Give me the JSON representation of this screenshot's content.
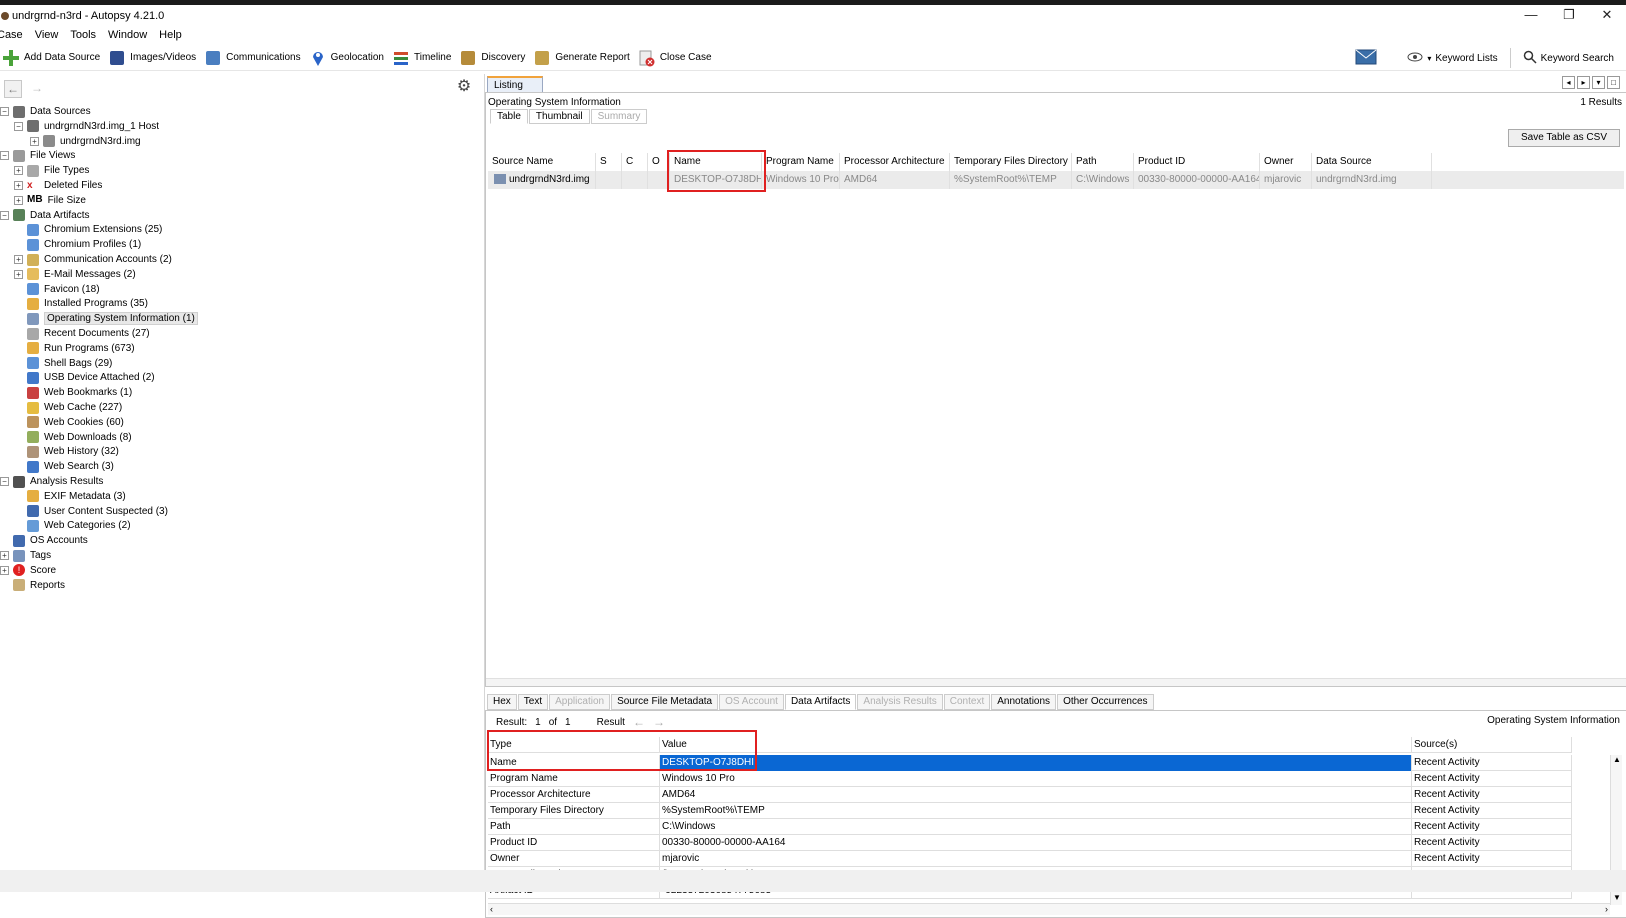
{
  "window": {
    "title": "undrgrnd-n3rd - Autopsy 4.21.0",
    "controls": [
      "—",
      "❐",
      "✕"
    ]
  },
  "menu": [
    "Case",
    "View",
    "Tools",
    "Window",
    "Help"
  ],
  "toolbar": {
    "buttons": [
      {
        "label": "Add Data Source",
        "icon": "plus-icon",
        "color": "#4aa33a"
      },
      {
        "label": "Images/Videos",
        "icon": "images-icon",
        "color": "#2f4d8f"
      },
      {
        "label": "Communications",
        "icon": "communications-icon",
        "color": "#4a7ec0"
      },
      {
        "label": "Geolocation",
        "icon": "map-pin-icon",
        "color": "#2a64c8"
      },
      {
        "label": "Timeline",
        "icon": "timeline-icon",
        "color": "#d04c2c"
      },
      {
        "label": "Discovery",
        "icon": "discovery-icon",
        "color": "#b58b3a"
      },
      {
        "label": "Generate Report",
        "icon": "report-icon",
        "color": "#c3a04a"
      },
      {
        "label": "Close Case",
        "icon": "close-case-icon",
        "color": "#d03030"
      }
    ],
    "keyword_lists": "Keyword Lists",
    "keyword_search": "Keyword Search"
  },
  "tree": {
    "items": [
      {
        "label": "Data Sources",
        "level": 0,
        "expander": "−",
        "icon": "data-sources-icon",
        "color": "#555"
      },
      {
        "label": "undrgrndN3rd.img_1 Host",
        "level": 1,
        "expander": "−",
        "icon": "host-icon",
        "color": "#555"
      },
      {
        "label": "undrgrndN3rd.img",
        "level": 2,
        "expander": "+",
        "icon": "disk-image-icon",
        "color": "#777"
      },
      {
        "label": "File Views",
        "level": 0,
        "expander": "−",
        "icon": "file-views-icon",
        "color": "#888"
      },
      {
        "label": "File Types",
        "level": 1,
        "expander": "+",
        "icon": "file-types-icon",
        "color": "#999"
      },
      {
        "label": "Deleted Files",
        "level": 1,
        "expander": "+",
        "icon": "deleted-files-icon",
        "color": "#d02020"
      },
      {
        "label": "File Size",
        "level": 1,
        "expander": "+",
        "icon": "file-size-icon",
        "color": "#000"
      },
      {
        "label": "Data Artifacts",
        "level": 0,
        "expander": "−",
        "icon": "data-artifacts-icon",
        "color": "#3b6b3b"
      },
      {
        "label": "Chromium Extensions (25)",
        "level": 1,
        "expander": "",
        "icon": "chromium-icon",
        "color": "#3f7fd0"
      },
      {
        "label": "Chromium Profiles (1)",
        "level": 1,
        "expander": "",
        "icon": "chromium-icon",
        "color": "#3f7fd0"
      },
      {
        "label": "Communication Accounts (2)",
        "level": 1,
        "expander": "+",
        "icon": "accounts-icon",
        "color": "#c9a23a"
      },
      {
        "label": "E-Mail Messages (2)",
        "level": 1,
        "expander": "+",
        "icon": "email-icon",
        "color": "#e0b040"
      },
      {
        "label": "Favicon (18)",
        "level": 1,
        "expander": "",
        "icon": "favicon-icon",
        "color": "#3f7fd0"
      },
      {
        "label": "Installed Programs (35)",
        "level": 1,
        "expander": "",
        "icon": "installed-programs-icon",
        "color": "#e0a020"
      },
      {
        "label": "Operating System Information (1)",
        "level": 1,
        "expander": "",
        "icon": "os-info-icon",
        "color": "#6a86b0",
        "selected": true
      },
      {
        "label": "Recent Documents (27)",
        "level": 1,
        "expander": "",
        "icon": "recent-documents-icon",
        "color": "#999"
      },
      {
        "label": "Run Programs (673)",
        "level": 1,
        "expander": "",
        "icon": "run-programs-icon",
        "color": "#e0a020"
      },
      {
        "label": "Shell Bags (29)",
        "level": 1,
        "expander": "",
        "icon": "shell-bags-icon",
        "color": "#3f7fd0"
      },
      {
        "label": "USB Device Attached (2)",
        "level": 1,
        "expander": "",
        "icon": "usb-icon",
        "color": "#2060c0"
      },
      {
        "label": "Web Bookmarks (1)",
        "level": 1,
        "expander": "",
        "icon": "bookmark-icon",
        "color": "#c02020"
      },
      {
        "label": "Web Cache (227)",
        "level": 1,
        "expander": "",
        "icon": "web-cache-icon",
        "color": "#e0b020"
      },
      {
        "label": "Web Cookies (60)",
        "level": 1,
        "expander": "",
        "icon": "cookie-icon",
        "color": "#b08040"
      },
      {
        "label": "Web Downloads (8)",
        "level": 1,
        "expander": "",
        "icon": "download-icon",
        "color": "#80a040"
      },
      {
        "label": "Web History (32)",
        "level": 1,
        "expander": "",
        "icon": "history-icon",
        "color": "#a08060"
      },
      {
        "label": "Web Search (3)",
        "level": 1,
        "expander": "",
        "icon": "web-search-icon",
        "color": "#2060c0"
      },
      {
        "label": "Analysis Results",
        "level": 0,
        "expander": "−",
        "icon": "analysis-results-icon",
        "color": "#333"
      },
      {
        "label": "EXIF Metadata (3)",
        "level": 1,
        "expander": "",
        "icon": "exif-icon",
        "color": "#e0a020"
      },
      {
        "label": "User Content Suspected (3)",
        "level": 1,
        "expander": "",
        "icon": "user-content-icon",
        "color": "#2050a0"
      },
      {
        "label": "Web Categories (2)",
        "level": 1,
        "expander": "",
        "icon": "web-categories-icon",
        "color": "#4a8ad0"
      },
      {
        "label": "OS Accounts",
        "level": 0,
        "expander": "",
        "icon": "os-accounts-icon",
        "color": "#2050a0"
      },
      {
        "label": "Tags",
        "level": 0,
        "expander": "+",
        "icon": "tags-icon",
        "color": "#6080b0"
      },
      {
        "label": "Score",
        "level": 0,
        "expander": "+",
        "icon": "score-icon",
        "color": "#e02020"
      },
      {
        "label": "Reports",
        "level": 0,
        "expander": "",
        "icon": "reports-icon",
        "color": "#c0a060"
      }
    ],
    "file_size_prefix": "MB"
  },
  "listing": {
    "tab": "Listing",
    "title": "Operating System Information",
    "results": "1 Results",
    "subtabs": [
      {
        "label": "Table",
        "state": "active"
      },
      {
        "label": "Thumbnail",
        "state": "normal"
      },
      {
        "label": "Summary",
        "state": "disabled"
      }
    ],
    "save_csv": "Save Table as CSV",
    "columns": [
      "Source Name",
      "S",
      "C",
      "O",
      "Name",
      "Program Name",
      "Processor Architecture",
      "Temporary Files Directory",
      "Path",
      "Product ID",
      "Owner",
      "Data Source"
    ],
    "row": [
      "undrgrndN3rd.img",
      "",
      "",
      "",
      "DESKTOP-O7J8DHI",
      "Windows 10 Pro",
      "AMD64",
      "%SystemRoot%\\TEMP",
      "C:\\Windows",
      "00330-80000-00000-AA164",
      "mjarovic",
      "undrgrndN3rd.img"
    ]
  },
  "viewer": {
    "tabs": [
      {
        "label": "Hex",
        "state": "normal"
      },
      {
        "label": "Text",
        "state": "normal"
      },
      {
        "label": "Application",
        "state": "disabled"
      },
      {
        "label": "Source File Metadata",
        "state": "normal"
      },
      {
        "label": "OS Account",
        "state": "disabled"
      },
      {
        "label": "Data Artifacts",
        "state": "active"
      },
      {
        "label": "Analysis Results",
        "state": "disabled"
      },
      {
        "label": "Context",
        "state": "disabled"
      },
      {
        "label": "Annotations",
        "state": "normal"
      },
      {
        "label": "Other Occurrences",
        "state": "normal"
      }
    ],
    "result_label": "Result:",
    "result_index": "1",
    "of_label": "of",
    "result_total": "1",
    "result_nav_label": "Result",
    "right_title": "Operating System Information",
    "headers": [
      "Type",
      "Value",
      "Source(s)"
    ],
    "rows": [
      {
        "type": "Name",
        "value": "DESKTOP-O7J8DHI",
        "source": "Recent Activity",
        "selected": true
      },
      {
        "type": "Program Name",
        "value": "Windows 10 Pro",
        "source": "Recent Activity"
      },
      {
        "type": "Processor Architecture",
        "value": "AMD64",
        "source": "Recent Activity"
      },
      {
        "type": "Temporary Files Directory",
        "value": "%SystemRoot%\\TEMP",
        "source": "Recent Activity"
      },
      {
        "type": "Path",
        "value": "C:\\Windows",
        "source": "Recent Activity"
      },
      {
        "type": "Product ID",
        "value": "00330-80000-00000-AA164",
        "source": "Recent Activity"
      },
      {
        "type": "Owner",
        "value": "mjarovic",
        "source": "Recent Activity"
      },
      {
        "type": "Source File Path",
        "value": "/img_undrgrndN3rd.img",
        "source": ""
      },
      {
        "type": "Artifact ID",
        "value": "-9223372036854775683",
        "source": ""
      }
    ]
  }
}
